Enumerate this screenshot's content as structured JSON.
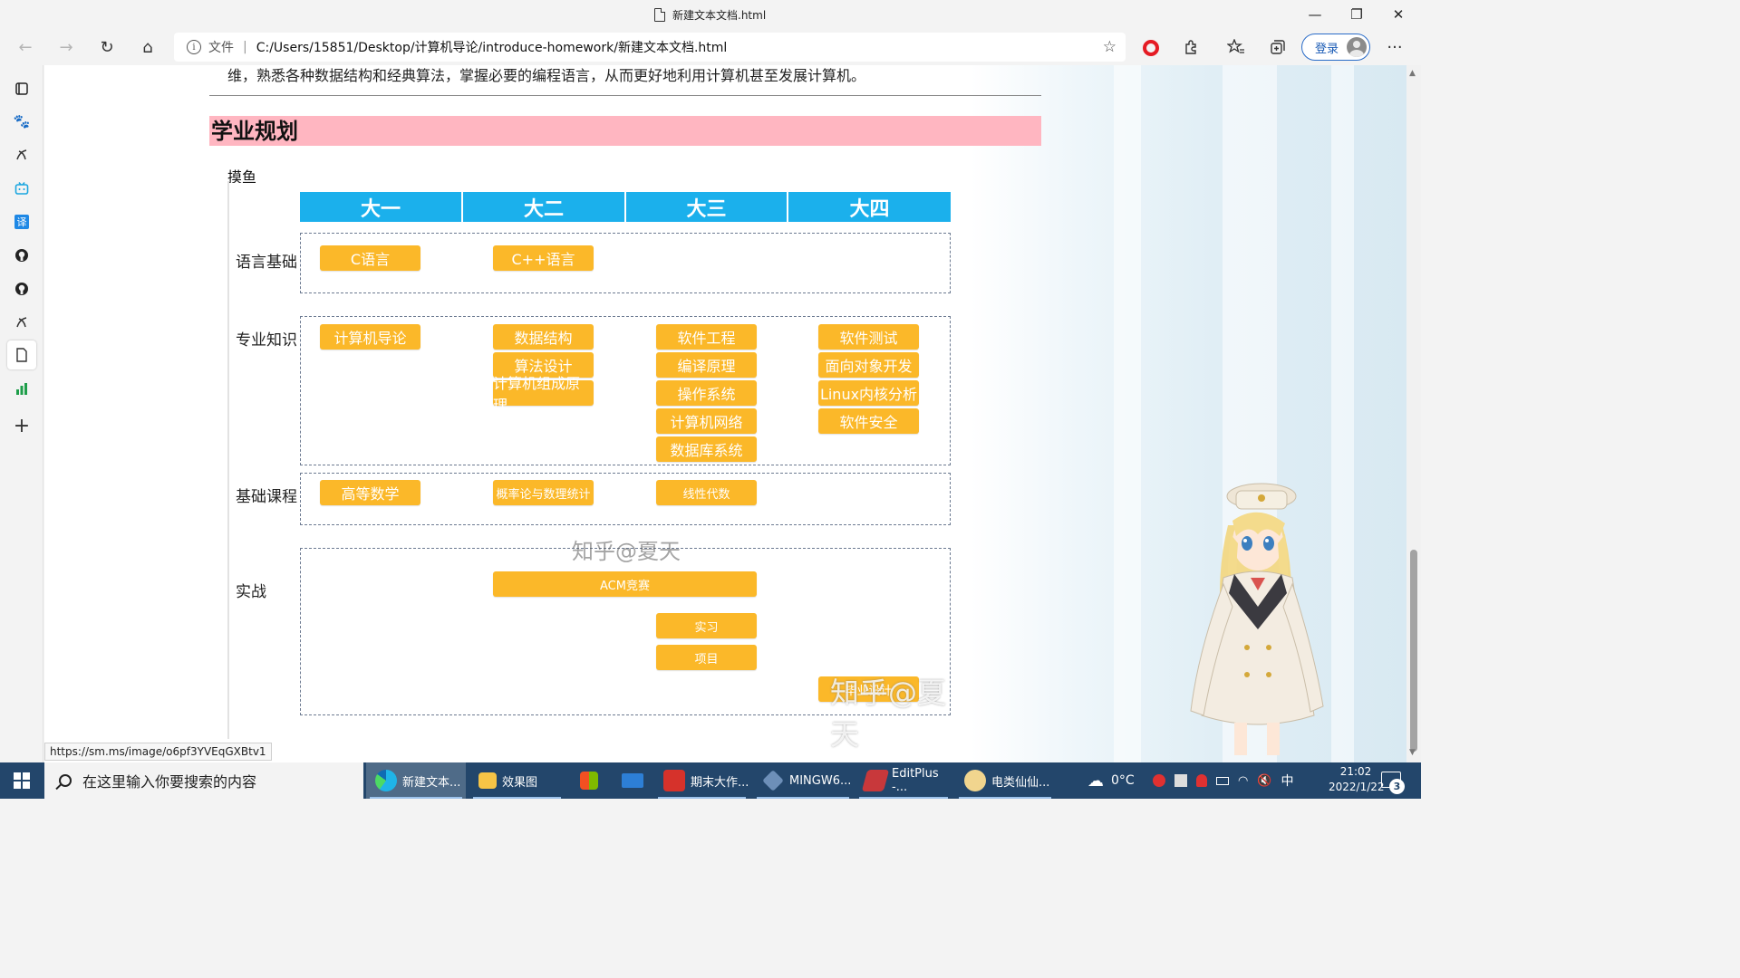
{
  "window": {
    "tab_title": "新建文本文档.html",
    "minimize": "—",
    "maximize": "❐",
    "close": "✕"
  },
  "toolbar": {
    "back": "←",
    "forward": "→",
    "refresh": "↻",
    "home": "⌂",
    "address_scheme": "文件",
    "address_url": "C:/Users/15851/Desktop/计算机导论/introduce-homework/新建文本文档.html",
    "login_label": "登录",
    "more": "···"
  },
  "page": {
    "intro_text": "维，熟悉各种数据结构和经典算法，掌握必要的编程语言，从而更好地利用计算机甚至发展计算机。",
    "section_title": "学业规划",
    "plan_caption": "摸鱼"
  },
  "plan": {
    "years": [
      "大一",
      "大二",
      "大三",
      "大四"
    ],
    "rows": [
      {
        "label": "语言基础"
      },
      {
        "label": "专业知识"
      },
      {
        "label": "基础课程"
      },
      {
        "label": "实战"
      }
    ],
    "courses": {
      "lang_1": "C语言",
      "lang_2": "C++语言",
      "pro_1": "计算机导论",
      "pro_2a": "数据结构",
      "pro_2b": "算法设计",
      "pro_2c": "计算机组成原理",
      "pro_3a": "软件工程",
      "pro_3b": "编译原理",
      "pro_3c": "操作系统",
      "pro_3d": "计算机网络",
      "pro_3e": "数据库系统",
      "pro_4a": "软件测试",
      "pro_4b": "面向对象开发",
      "pro_4c": "Linux内核分析",
      "pro_4d": "软件安全",
      "base_1": "高等数学",
      "base_2": "概率论与数理统计",
      "base_3": "线性代数",
      "prac_acm": "ACM竞赛",
      "prac_intern": "实习",
      "prac_project": "项目",
      "prac_other": "毕业设计"
    },
    "watermark_small": "知乎@夏天",
    "watermark_big": "知乎@夏天"
  },
  "status_bar": {
    "link": "https://sm.ms/image/o6pf3YVEqGXBtv1"
  },
  "taskbar": {
    "search_placeholder": "在这里输入你要搜索的内容",
    "items": [
      {
        "label": "新建文本..."
      },
      {
        "label": "效果图"
      },
      {
        "label": ""
      },
      {
        "label": ""
      },
      {
        "label": "期末大作..."
      },
      {
        "label": "MINGW6..."
      },
      {
        "label": "EditPlus -..."
      },
      {
        "label": "电类仙仙..."
      }
    ],
    "temperature": "0°C",
    "ime": "中",
    "time": "21:02",
    "date": "2022/1/22",
    "notification_count": "3"
  },
  "colors": {
    "accent": "#1bb0ec",
    "course": "#fbb829",
    "section_bg": "#ffb6c1",
    "taskbar": "#23466b",
    "login": "#2a6cc8"
  }
}
